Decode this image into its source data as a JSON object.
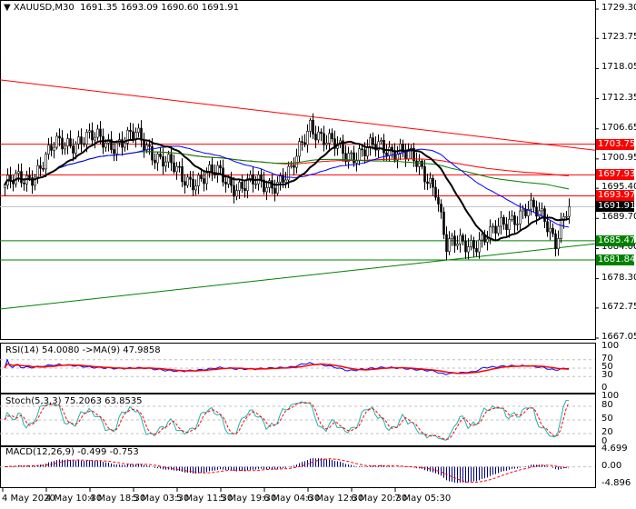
{
  "header": {
    "symbol": "XAUUSD,M30",
    "ohlc": "1691.35 1693.09 1690.60 1691.91"
  },
  "price_axis": [
    "1729.30",
    "1723.75",
    "1718.05",
    "1712.35",
    "1706.65",
    "1700.95",
    "1695.40",
    "1689.70",
    "1684.00",
    "1678.30",
    "1672.75",
    "1667.05"
  ],
  "price_tags": [
    {
      "value": "1703.75",
      "color": "#ff0000"
    },
    {
      "value": "1697.93",
      "color": "#ff0000"
    },
    {
      "value": "1693.97",
      "color": "#ff0000"
    },
    {
      "value": "1691.91",
      "color": "#000000"
    },
    {
      "value": "1685.47",
      "color": "#008000"
    },
    {
      "value": "1681.84",
      "color": "#008000"
    }
  ],
  "rsi": {
    "title": "RSI(14) 54.0080  ->MA(9) 47.9858",
    "levels": [
      "100",
      "70",
      "50",
      "30",
      "0"
    ]
  },
  "stoch": {
    "title": "Stoch(5,3,3) 75.2063 63.8535",
    "levels": [
      "100",
      "80",
      "50",
      "20",
      "0"
    ]
  },
  "macd": {
    "title": "MACD(12,26,9) -0.499 -0.753",
    "levels": [
      "4.699",
      "0.00",
      "-4.896"
    ]
  },
  "time_axis": [
    "4 May 2020",
    "4 May 10:30",
    "4 May 18:30",
    "5 May 03:30",
    "5 May 11:30",
    "5 May 19:30",
    "6 May 04:30",
    "6 May 12:30",
    "6 May 20:30",
    "7 May 05:30"
  ],
  "chart_data": {
    "type": "candlestick",
    "bars": 208,
    "keypoints": [
      [
        0,
        1696
      ],
      [
        8,
        1697
      ],
      [
        18,
        1703
      ],
      [
        28,
        1705
      ],
      [
        38,
        1704
      ],
      [
        48,
        1705
      ],
      [
        58,
        1701
      ],
      [
        65,
        1697
      ],
      [
        78,
        1698
      ],
      [
        85,
        1696
      ],
      [
        95,
        1696
      ],
      [
        105,
        1698
      ],
      [
        112,
        1708
      ],
      [
        118,
        1704
      ],
      [
        125,
        1702
      ],
      [
        138,
        1703
      ],
      [
        145,
        1703
      ],
      [
        152,
        1699
      ],
      [
        158,
        1696
      ],
      [
        162,
        1684
      ],
      [
        168,
        1685
      ],
      [
        178,
        1686
      ],
      [
        185,
        1690
      ],
      [
        192,
        1691
      ],
      [
        198,
        1690
      ],
      [
        202,
        1686
      ],
      [
        207,
        1691.91
      ]
    ],
    "trendlines": [
      {
        "color": "#ff0000",
        "from": 1715.9,
        "to": 1702.6
      },
      {
        "color": "#008000",
        "from": 1672.55,
        "to": 1684.9
      }
    ],
    "hlines": [
      {
        "v": 1703.75,
        "c": "#ff0000"
      },
      {
        "v": 1697.93,
        "c": "#ff0000"
      },
      {
        "v": 1693.97,
        "c": "#ff0000"
      },
      {
        "v": 1691.91,
        "c": "#c0c0c0"
      },
      {
        "v": 1685.47,
        "c": "#008000"
      },
      {
        "v": 1681.84,
        "c": "#008000"
      }
    ],
    "ylim": [
      1667.05,
      1729.3
    ]
  }
}
